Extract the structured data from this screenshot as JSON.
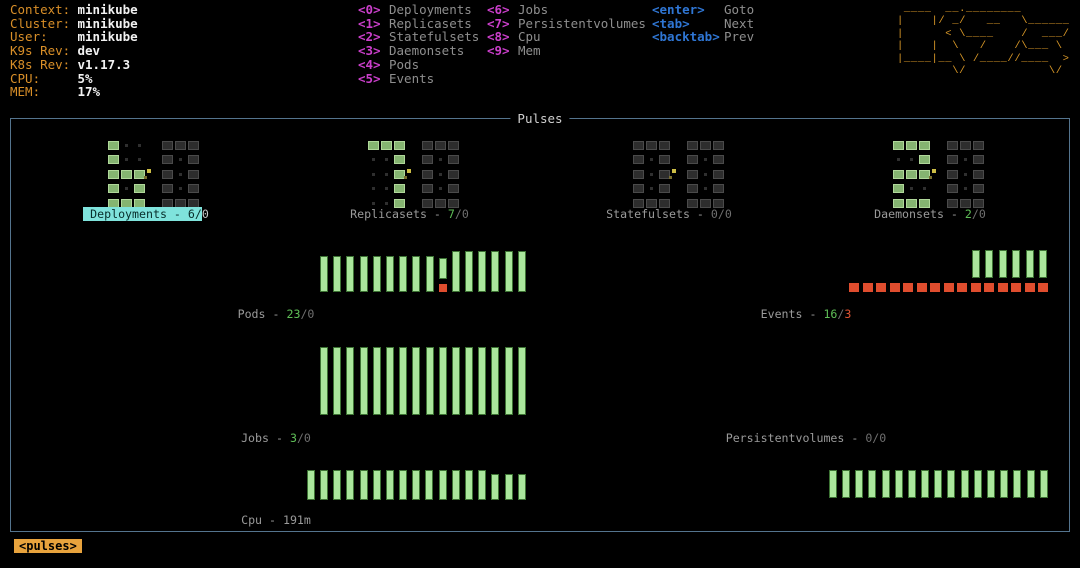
{
  "cluster_info": [
    {
      "label": "Context:",
      "value": "minikube"
    },
    {
      "label": "Cluster:",
      "value": "minikube"
    },
    {
      "label": "User:",
      "value": "minikube"
    },
    {
      "label": "K9s Rev:",
      "value": "dev"
    },
    {
      "label": "K8s Rev:",
      "value": "v1.17.3"
    },
    {
      "label": "CPU:",
      "value": "5%"
    },
    {
      "label": "MEM:",
      "value": "17%"
    }
  ],
  "menu": {
    "col1": [
      {
        "key": "<0>",
        "label": "Deployments"
      },
      {
        "key": "<1>",
        "label": "Replicasets"
      },
      {
        "key": "<2>",
        "label": "Statefulsets"
      },
      {
        "key": "<3>",
        "label": "Daemonsets"
      },
      {
        "key": "<4>",
        "label": "Pods"
      },
      {
        "key": "<5>",
        "label": "Events"
      }
    ],
    "col2": [
      {
        "key": "<6>",
        "label": "Jobs"
      },
      {
        "key": "<7>",
        "label": "Persistentvolumes"
      },
      {
        "key": "<8>",
        "label": "Cpu"
      },
      {
        "key": "<9>",
        "label": "Mem"
      }
    ],
    "col3": [
      {
        "key": "<enter>",
        "label": "Goto"
      },
      {
        "key": "<tab>",
        "label": "Next"
      },
      {
        "key": "<backtab>",
        "label": "Prev"
      }
    ]
  },
  "logo_lines": [
    " ____  __.________",
    "|    |/ _/   __   \\______",
    "|      < \\____    /  ___/",
    "|    |  \\   /    /\\___ \\",
    "|____|__ \\ /____//____  >",
    "        \\/            \\/"
  ],
  "pulses": {
    "title": "Pulses",
    "crumb": "<pulses>"
  },
  "colors": {
    "orange": "#dc9a28",
    "magenta": "#cb3fcb",
    "blue": "#2f76d4",
    "gray": "#8e8e8e",
    "green_bar": "#aae69c",
    "red_bar": "#df4d2e",
    "ok_green": "#5fbf57",
    "err_red": "#e25433",
    "highlight_cyan": "#7fe3dc",
    "border_blue": "#54748e",
    "crumb_orange": "#e8a33d"
  },
  "chart_data": [
    {
      "id": "deployments",
      "type": "digit-matrix",
      "title": "Deployments",
      "ok": 6,
      "err": 0,
      "selected": true,
      "digits": [
        {
          "value": 6,
          "lit": "green"
        },
        {
          "value": 0,
          "lit": "gray"
        }
      ],
      "label_segments": [
        {
          "t": " Deployments - 6/",
          "s": "hl"
        },
        {
          "t": "0",
          "s": "tail"
        }
      ]
    },
    {
      "id": "replicasets",
      "type": "digit-matrix",
      "title": "Replicasets",
      "ok": 7,
      "err": 0,
      "selected": false,
      "digits": [
        {
          "value": 7,
          "lit": "green"
        },
        {
          "value": 0,
          "lit": "gray"
        }
      ],
      "label_segments": [
        {
          "t": "Replicasets - ",
          "s": "g"
        },
        {
          "t": "7",
          "s": "ok"
        },
        {
          "t": "/0",
          "s": "dim"
        }
      ]
    },
    {
      "id": "statefulsets",
      "type": "digit-matrix",
      "title": "Statefulsets",
      "ok": 0,
      "err": 0,
      "selected": false,
      "digits": [
        {
          "value": 0,
          "lit": "gray"
        },
        {
          "value": 0,
          "lit": "gray"
        }
      ],
      "label_segments": [
        {
          "t": "Statefulsets - ",
          "s": "g"
        },
        {
          "t": "0/0",
          "s": "dim"
        }
      ]
    },
    {
      "id": "daemonsets",
      "type": "digit-matrix",
      "title": "Daemonsets",
      "ok": 2,
      "err": 0,
      "selected": false,
      "digits": [
        {
          "value": 2,
          "lit": "green"
        },
        {
          "value": 0,
          "lit": "gray"
        }
      ],
      "label_segments": [
        {
          "t": "Daemonsets - ",
          "s": "g"
        },
        {
          "t": "2",
          "s": "ok"
        },
        {
          "t": "/0",
          "s": "dim"
        }
      ]
    },
    {
      "id": "pods",
      "type": "bar",
      "title": "Pods",
      "ok": 23,
      "err": 0,
      "samples": [
        [
          36,
          0
        ],
        [
          36,
          0
        ],
        [
          36,
          0
        ],
        [
          36,
          0
        ],
        [
          36,
          0
        ],
        [
          36,
          0
        ],
        [
          36,
          0
        ],
        [
          36,
          0
        ],
        [
          36,
          0
        ],
        [
          21,
          8
        ],
        [
          41,
          0
        ],
        [
          41,
          0
        ],
        [
          41,
          0
        ],
        [
          41,
          0
        ],
        [
          41,
          0
        ],
        [
          41,
          0
        ]
      ],
      "label_segments": [
        {
          "t": "Pods - ",
          "s": "g"
        },
        {
          "t": "23",
          "s": "ok"
        },
        {
          "t": "/0",
          "s": "dim"
        }
      ]
    },
    {
      "id": "events",
      "type": "bar",
      "title": "Events",
      "ok": 16,
      "err": 3,
      "samples": [
        [
          0,
          9
        ],
        [
          0,
          9
        ],
        [
          0,
          9
        ],
        [
          0,
          9
        ],
        [
          0,
          9
        ],
        [
          0,
          9
        ],
        [
          0,
          9
        ],
        [
          0,
          9
        ],
        [
          0,
          9
        ],
        [
          28,
          9
        ],
        [
          28,
          9
        ],
        [
          28,
          9
        ],
        [
          28,
          9
        ],
        [
          28,
          9
        ],
        [
          28,
          9
        ]
      ],
      "label_segments": [
        {
          "t": "Events - ",
          "s": "g"
        },
        {
          "t": "16",
          "s": "ok"
        },
        {
          "t": "/",
          "s": "dim"
        },
        {
          "t": "3",
          "s": "err"
        }
      ]
    },
    {
      "id": "jobs",
      "type": "bar",
      "title": "Jobs",
      "ok": 3,
      "err": 0,
      "samples": [
        [
          68,
          0
        ],
        [
          68,
          0
        ],
        [
          68,
          0
        ],
        [
          68,
          0
        ],
        [
          68,
          0
        ],
        [
          68,
          0
        ],
        [
          68,
          0
        ],
        [
          68,
          0
        ],
        [
          68,
          0
        ],
        [
          68,
          0
        ],
        [
          68,
          0
        ],
        [
          68,
          0
        ],
        [
          68,
          0
        ],
        [
          68,
          0
        ],
        [
          68,
          0
        ],
        [
          68,
          0
        ]
      ],
      "label_segments": [
        {
          "t": "Jobs - ",
          "s": "g"
        },
        {
          "t": "3",
          "s": "ok"
        },
        {
          "t": "/0",
          "s": "dim"
        }
      ]
    },
    {
      "id": "persistentvolumes",
      "type": "bar",
      "title": "Persistentvolumes",
      "ok": 0,
      "err": 0,
      "samples": [],
      "label_segments": [
        {
          "t": "Persistentvolumes - ",
          "s": "g"
        },
        {
          "t": "0/0",
          "s": "dim"
        }
      ]
    },
    {
      "id": "cpu",
      "type": "bar",
      "title": "Cpu",
      "value": "191m",
      "samples": [
        [
          30,
          0
        ],
        [
          30,
          0
        ],
        [
          30,
          0
        ],
        [
          30,
          0
        ],
        [
          30,
          0
        ],
        [
          30,
          0
        ],
        [
          30,
          0
        ],
        [
          30,
          0
        ],
        [
          30,
          0
        ],
        [
          30,
          0
        ],
        [
          30,
          0
        ],
        [
          30,
          0
        ],
        [
          30,
          0
        ],
        [
          30,
          0
        ],
        [
          26,
          0
        ],
        [
          26,
          0
        ],
        [
          26,
          0
        ]
      ],
      "label_segments": [
        {
          "t": "Cpu - 191m",
          "s": "g"
        }
      ]
    },
    {
      "id": "mem",
      "type": "bar",
      "title": "Mem",
      "samples": [
        [
          28,
          0
        ],
        [
          28,
          0
        ],
        [
          28,
          0
        ],
        [
          28,
          0
        ],
        [
          28,
          0
        ],
        [
          28,
          0
        ],
        [
          28,
          0
        ],
        [
          28,
          0
        ],
        [
          28,
          0
        ],
        [
          28,
          0
        ],
        [
          28,
          0
        ],
        [
          28,
          0
        ],
        [
          28,
          0
        ],
        [
          28,
          0
        ],
        [
          28,
          0
        ],
        [
          28,
          0
        ],
        [
          28,
          0
        ]
      ],
      "label_segments": []
    }
  ]
}
